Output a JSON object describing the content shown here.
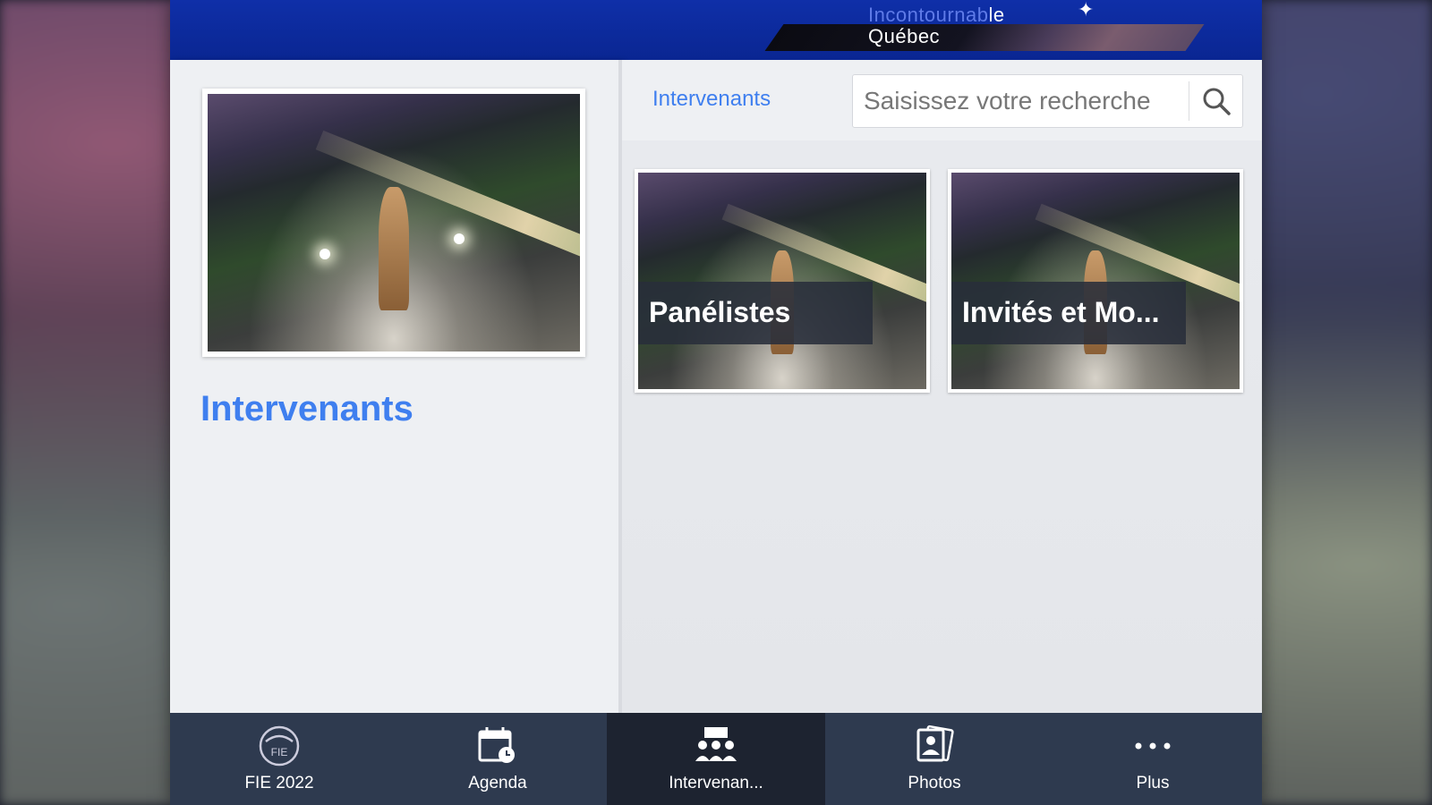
{
  "header": {
    "logo_line1_a": "Incontournab",
    "logo_line1_b": "le",
    "logo_line2": "Québec",
    "logo_star": "✦"
  },
  "left_panel": {
    "hero_icon": "night-city-statue-photo",
    "title": "Intervenants"
  },
  "right_panel": {
    "breadcrumb": "Intervenants",
    "search": {
      "placeholder": "Saisissez votre recherche",
      "value": "",
      "icon": "search-icon"
    },
    "tiles": [
      {
        "label": "Panélistes"
      },
      {
        "label": "Invités et Mo..."
      }
    ]
  },
  "bottom_nav": {
    "items": [
      {
        "label": "FIE 2022",
        "icon": "fie-logo-icon",
        "active": false
      },
      {
        "label": "Agenda",
        "icon": "calendar-icon",
        "active": false
      },
      {
        "label": "Intervenan...",
        "icon": "people-icon",
        "active": true
      },
      {
        "label": "Photos",
        "icon": "photos-icon",
        "active": false
      },
      {
        "label": "Plus",
        "icon": "more-icon",
        "active": false
      }
    ]
  },
  "colors": {
    "header_blue": "#0f2fa8",
    "accent_blue": "#3f7fef",
    "nav_bg": "#2e3a4f",
    "nav_active_bg": "#1d2330"
  }
}
